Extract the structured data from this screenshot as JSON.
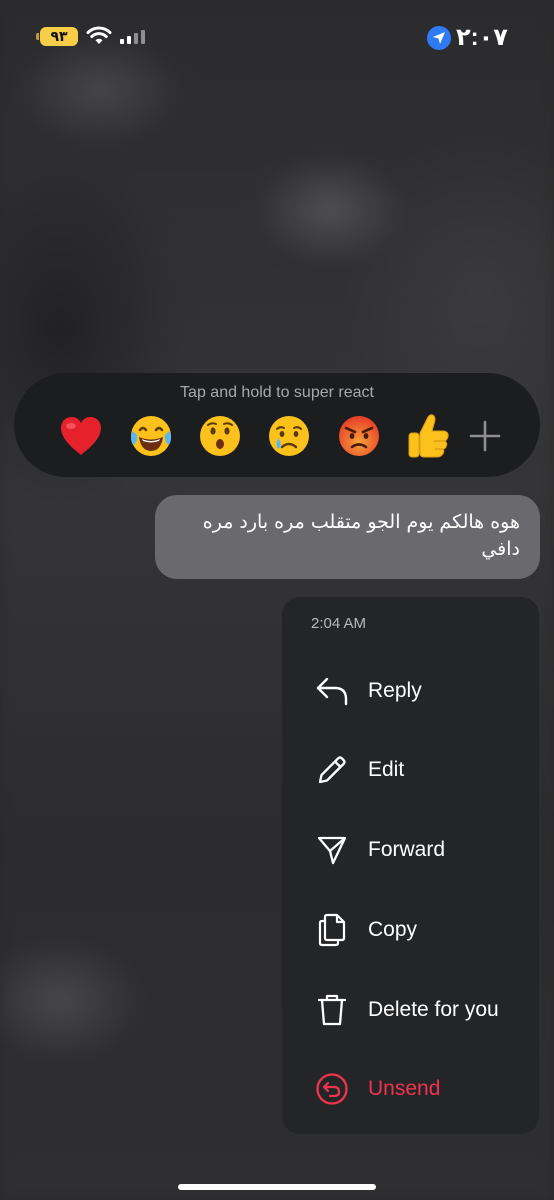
{
  "status_bar": {
    "battery": "٩٣",
    "time": "٢:٠٧",
    "icons": [
      "wifi-icon",
      "signal-icon",
      "location-arrow-icon"
    ]
  },
  "reaction_tray": {
    "hint": "Tap and hold to super react",
    "reactions": [
      {
        "name": "red-heart",
        "glyph": "❤️"
      },
      {
        "name": "tears-of-joy",
        "glyph": "😂"
      },
      {
        "name": "hushed-face",
        "glyph": "😮"
      },
      {
        "name": "crying-face",
        "glyph": "😢"
      },
      {
        "name": "angry-face",
        "glyph": "😡"
      },
      {
        "name": "thumbs-up",
        "glyph": "👍"
      }
    ],
    "more_icon": "plus-icon"
  },
  "message": {
    "text": "هوه هالكم يوم الجو متقلب مره بارد مره دافي"
  },
  "menu": {
    "timestamp": "2:04 AM",
    "items": [
      {
        "label": "Reply",
        "icon": "reply-arrow-icon"
      },
      {
        "label": "Edit",
        "icon": "pencil-icon"
      },
      {
        "label": "Forward",
        "icon": "paper-plane-icon"
      },
      {
        "label": "Copy",
        "icon": "copy-icon"
      },
      {
        "label": "Delete for you",
        "icon": "trash-icon"
      },
      {
        "label": "Unsend",
        "icon": "unsend-icon"
      }
    ]
  },
  "colors": {
    "accent_danger": "#f0344f",
    "battery": "#f7ce46",
    "location": "#2f7bf5",
    "bubble": "#6a6a6e",
    "menu_bg": "#242527",
    "tray_bg": "#1c1d1f"
  }
}
